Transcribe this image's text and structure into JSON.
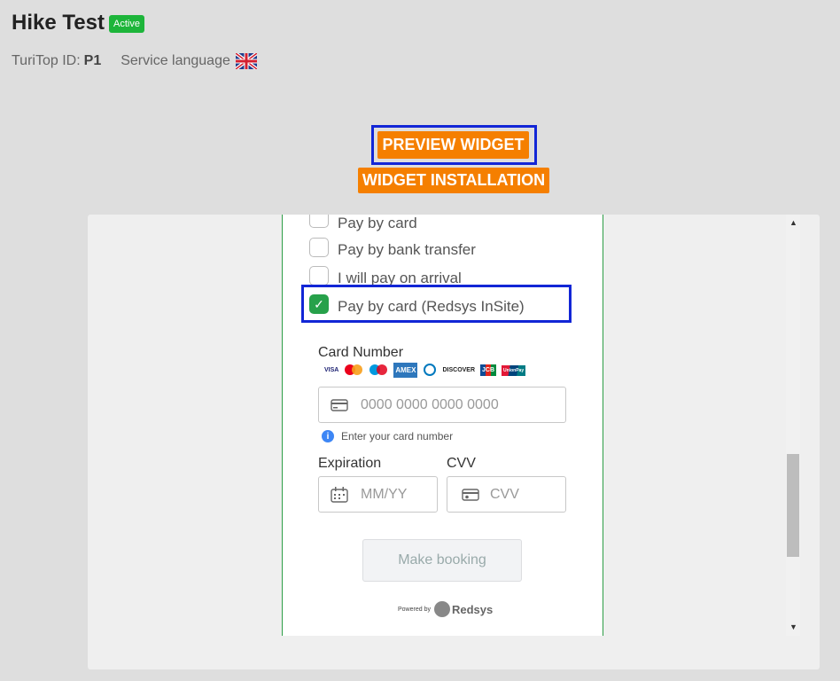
{
  "header": {
    "title": "Hike Test",
    "status_badge": "Active",
    "turitop_label": "TuriTop ID:",
    "turitop_id": "P1",
    "service_language_label": "Service language"
  },
  "buttons": {
    "preview_widget": "PREVIEW WIDGET",
    "widget_installation": "WIDGET INSTALLATION"
  },
  "widget": {
    "payment_options": [
      {
        "label": "Pay by card",
        "checked": false
      },
      {
        "label": "Pay by bank transfer",
        "checked": false
      },
      {
        "label": "I will pay on arrival",
        "checked": false
      },
      {
        "label": "Pay by card (Redsys InSite)",
        "checked": true
      }
    ],
    "card_number_label": "Card Number",
    "card_brands": [
      "VISA",
      "mastercard",
      "maestro",
      "AMEX",
      "Diners Club",
      "DISCOVER",
      "JCB",
      "UnionPay"
    ],
    "card_number_placeholder": "0000 0000 0000 0000",
    "card_hint": "Enter your card number",
    "expiration_label": "Expiration",
    "expiration_placeholder": "MM/YY",
    "cvv_label": "CVV",
    "cvv_placeholder": "CVV",
    "make_booking": "Make booking",
    "powered_by": "Powered by",
    "provider": "Redsys"
  },
  "colors": {
    "accent_orange": "#f57f00",
    "active_green": "#1db53a",
    "highlight_blue": "#1226d6"
  }
}
